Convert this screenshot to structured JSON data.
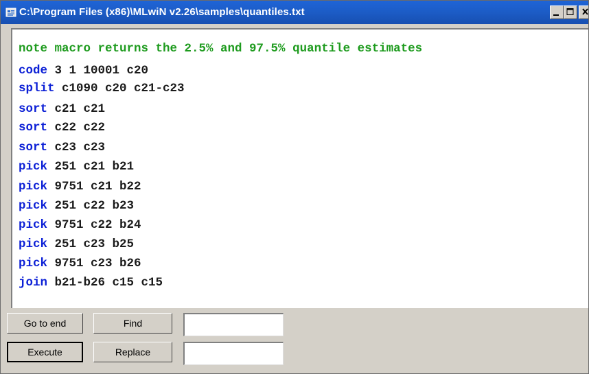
{
  "window": {
    "title": "C:\\Program Files (x86)\\MLwiN v2.26\\samples\\quantiles.txt",
    "controls": [
      "minimize",
      "maximize",
      "close"
    ]
  },
  "editor": {
    "lines": [
      {
        "keyword": "note macro returns the 2.5% and 97.5% quantile estimates",
        "rest": "",
        "type": "note"
      },
      {
        "keyword": "code",
        "rest": " 3 1 10001 c20",
        "type": "cmd"
      },
      {
        "keyword": "split",
        "rest": " c1090 c20 c21-c23",
        "type": "cmd"
      },
      {
        "keyword": "sort",
        "rest": " c21 c21",
        "type": "cmd"
      },
      {
        "keyword": "sort",
        "rest": " c22 c22",
        "type": "cmd"
      },
      {
        "keyword": "sort",
        "rest": " c23 c23",
        "type": "cmd"
      },
      {
        "keyword": "pick",
        "rest": " 251 c21 b21",
        "type": "cmd"
      },
      {
        "keyword": "pick",
        "rest": " 9751 c21 b22",
        "type": "cmd"
      },
      {
        "keyword": "pick",
        "rest": " 251 c22 b23",
        "type": "cmd"
      },
      {
        "keyword": "pick",
        "rest": " 9751 c22 b24",
        "type": "cmd"
      },
      {
        "keyword": "pick",
        "rest": " 251 c23 b25",
        "type": "cmd"
      },
      {
        "keyword": "pick",
        "rest": " 9751 c23 b26",
        "type": "cmd"
      },
      {
        "keyword": "join",
        "rest": " b21-b26 c15 c15",
        "type": "cmd"
      }
    ]
  },
  "toolbar": {
    "go_to_end_label": "Go to end",
    "find_label": "Find",
    "find_value": "",
    "execute_label": "Execute",
    "replace_label": "Replace",
    "replace_value": ""
  },
  "colors": {
    "keyword": "#0b1fd6",
    "note": "#1e9b1e",
    "titlebar": "#1c5cc6"
  }
}
